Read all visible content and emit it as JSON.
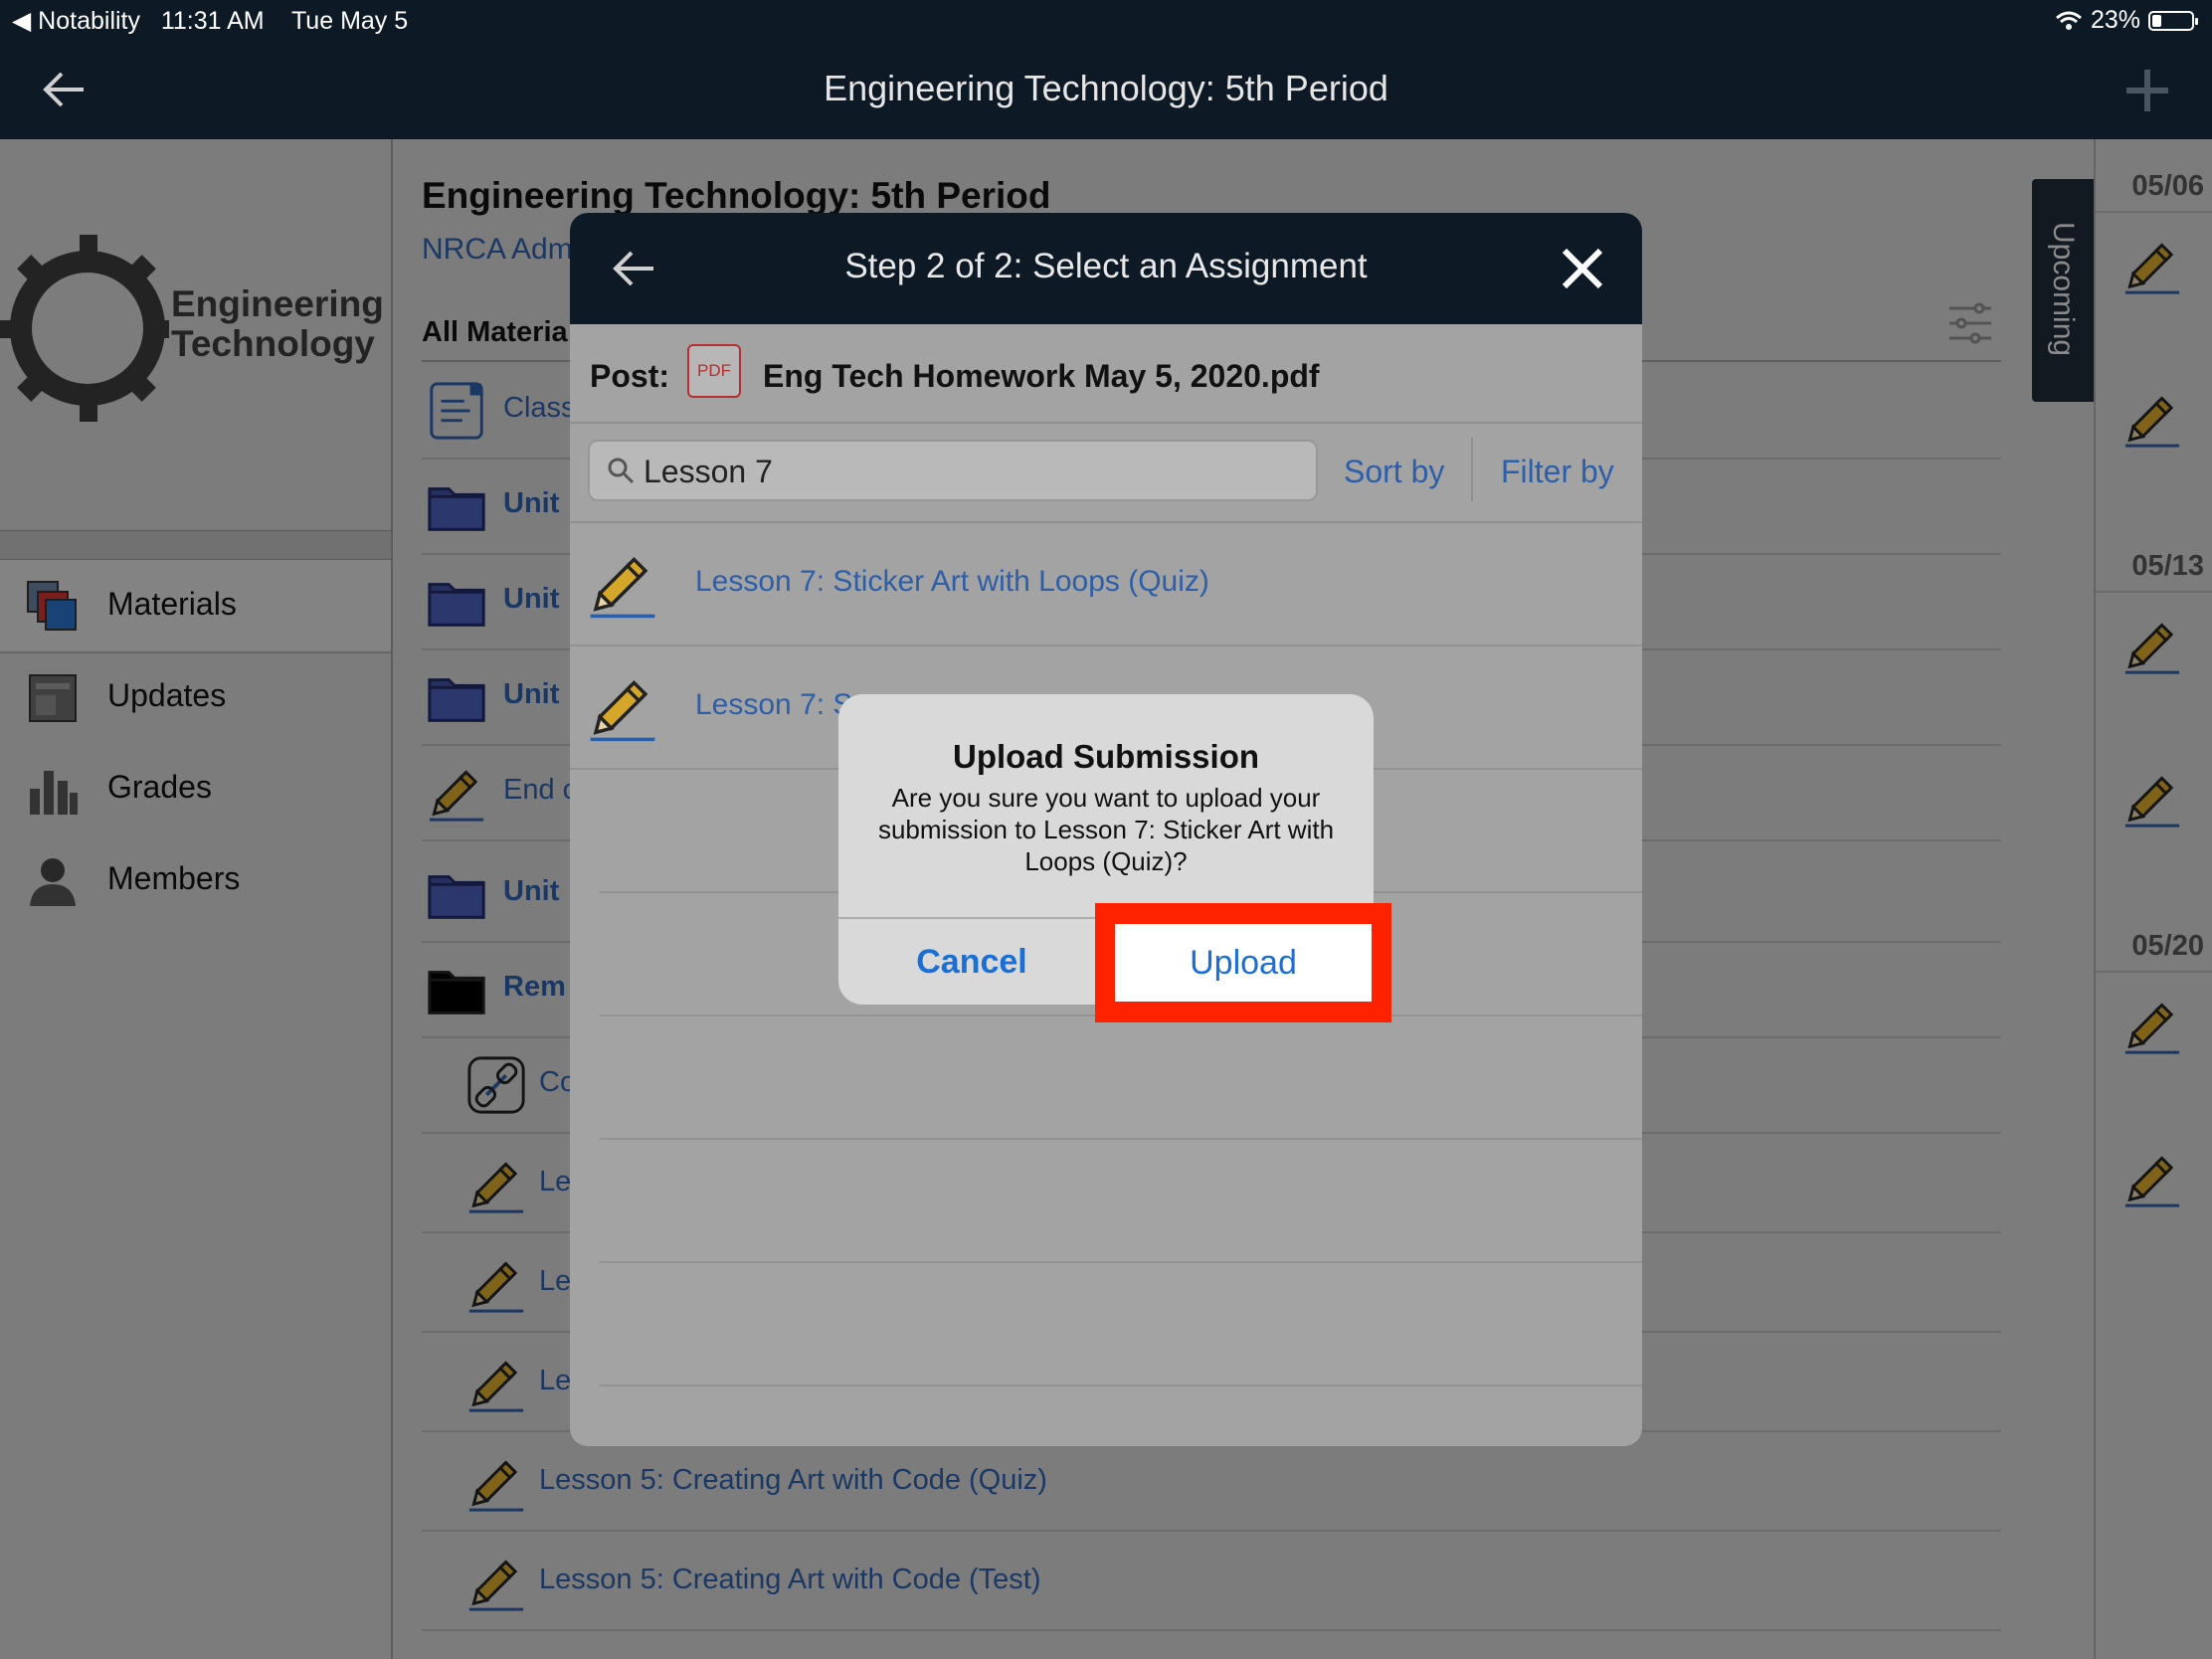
{
  "status": {
    "back_app": "◀ Notability",
    "time": "11:31 AM",
    "date": "Tue May 5",
    "battery": "23%",
    "battery_fraction": 0.23
  },
  "nav": {
    "title": "Engineering Technology: 5th Period"
  },
  "sidebar": {
    "logo_line1": "Engineering",
    "logo_line2": "Technology",
    "items": [
      {
        "label": "Materials",
        "icon": "materials-icon"
      },
      {
        "label": "Updates",
        "icon": "updates-icon"
      },
      {
        "label": "Grades",
        "icon": "grades-icon"
      },
      {
        "label": "Members",
        "icon": "members-icon"
      }
    ]
  },
  "course": {
    "title": "Engineering Technology: 5th Period",
    "subtitle": "NRCA Adm",
    "section": "All Materia",
    "rows": [
      {
        "label": "Class",
        "icon": "document-icon"
      },
      {
        "label": "Unit",
        "icon": "folder-icon"
      },
      {
        "label": "Unit",
        "icon": "folder-icon"
      },
      {
        "label": "Unit",
        "icon": "folder-icon"
      },
      {
        "label": "End o",
        "icon": "pencil-icon"
      },
      {
        "label": "Unit",
        "icon": "folder-icon"
      },
      {
        "label": "Rem",
        "icon": "folder-icon"
      },
      {
        "label": "Co",
        "icon": "link-icon"
      },
      {
        "label": "Le",
        "icon": "pencil-icon"
      },
      {
        "label": "Le",
        "icon": "pencil-icon"
      },
      {
        "label": "Le",
        "icon": "pencil-icon"
      },
      {
        "label": "Lesson 5: Creating Art with Code (Quiz)",
        "icon": "pencil-icon"
      },
      {
        "label": "Lesson 5: Creating Art with Code (Test)",
        "icon": "pencil-icon"
      }
    ]
  },
  "upcoming": {
    "label": "Upcoming",
    "dates": [
      "05/06",
      "05/13",
      "05/20"
    ]
  },
  "modal": {
    "title": "Step 2 of 2: Select an Assignment",
    "post_label": "Post:",
    "pdf_badge": "PDF",
    "post_file": "Eng Tech Homework May 5, 2020.pdf",
    "search_value": "Lesson 7",
    "sort_by": "Sort by",
    "filter_by": "Filter by",
    "results": [
      {
        "label": "Lesson 7: Sticker Art with Loops (Quiz)"
      },
      {
        "label": "Lesson 7: S"
      }
    ]
  },
  "alert": {
    "title": "Upload Submission",
    "message": "Are you sure you want to upload your submission to Lesson 7: Sticker Art with Loops (Quiz)?",
    "cancel": "Cancel",
    "upload": "Upload"
  },
  "colors": {
    "navbar": "#0d1a26",
    "link": "#2d5ea8",
    "ios_blue": "#1a6fd6",
    "highlight": "#ff2200",
    "pencil": "#d4a62a"
  }
}
